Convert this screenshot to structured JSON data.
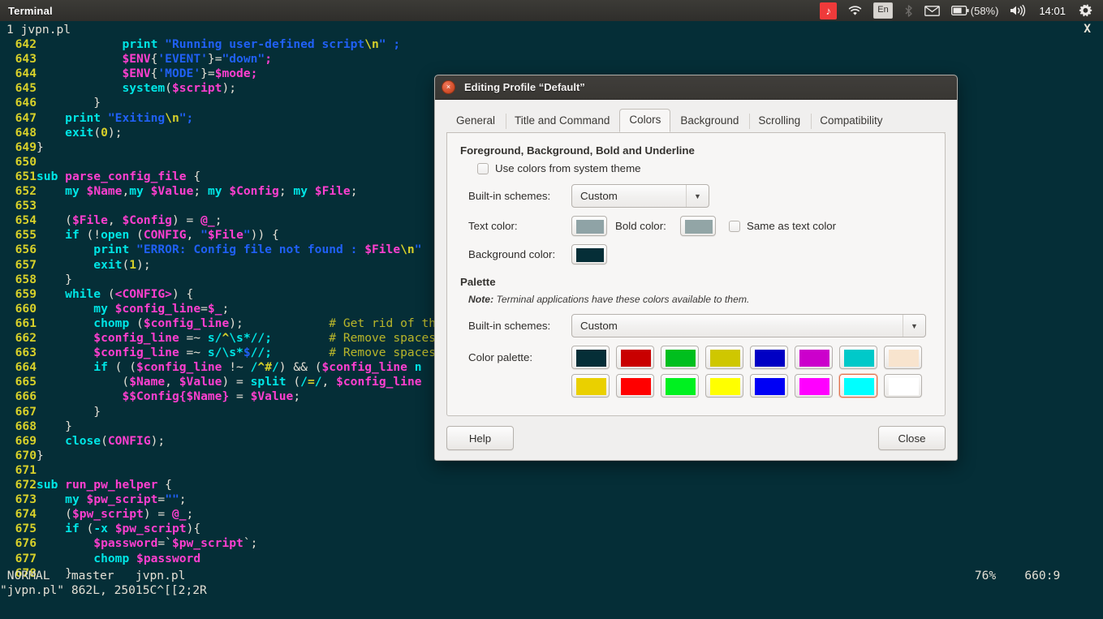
{
  "panel": {
    "title": "Terminal",
    "tray": {
      "music_icon": "music-note-icon",
      "wifi_icon": "wifi-icon",
      "language": "En",
      "bluetooth_icon": "bluetooth-icon",
      "mail_icon": "envelope-icon",
      "battery_icon": "battery-icon",
      "battery_percent": "(58%)",
      "volume_icon": "volume-icon",
      "clock": "14:01",
      "settings_icon": "gear-icon"
    }
  },
  "terminal": {
    "tab_label": "1 jvpn.pl",
    "close_glyph": "X",
    "colors": {
      "background": "#052e37",
      "foreground": "#e3dfd4",
      "linenumber": "#d7d02a",
      "keyword": "#00e5e5",
      "variable": "#ff3fd0",
      "string": "#2060f5",
      "comment": "#b9b62a"
    },
    "lines": [
      {
        "n": "642",
        "segs": [
          {
            "t": "            ",
            "c": "pln"
          },
          {
            "t": "print",
            "c": "kw"
          },
          {
            "t": " ",
            "c": "pln"
          },
          {
            "t": "\"Running user-defined script",
            "c": "str"
          },
          {
            "t": "\\n",
            "c": "esc"
          },
          {
            "t": "\" ;",
            "c": "str"
          }
        ]
      },
      {
        "n": "643",
        "segs": [
          {
            "t": "            ",
            "c": "pln"
          },
          {
            "t": "$ENV",
            "c": "var"
          },
          {
            "t": "{",
            "c": "pln"
          },
          {
            "t": "'EVENT'",
            "c": "str"
          },
          {
            "t": "}=",
            "c": "pln"
          },
          {
            "t": "\"down\"",
            "c": "str"
          },
          {
            "t": ";",
            "c": "var"
          }
        ]
      },
      {
        "n": "644",
        "segs": [
          {
            "t": "            ",
            "c": "pln"
          },
          {
            "t": "$ENV",
            "c": "var"
          },
          {
            "t": "{",
            "c": "pln"
          },
          {
            "t": "'MODE'",
            "c": "str"
          },
          {
            "t": "}=",
            "c": "pln"
          },
          {
            "t": "$mode",
            "c": "var"
          },
          {
            "t": ";",
            "c": "var"
          }
        ]
      },
      {
        "n": "645",
        "segs": [
          {
            "t": "            ",
            "c": "pln"
          },
          {
            "t": "system",
            "c": "kw"
          },
          {
            "t": "(",
            "c": "pln"
          },
          {
            "t": "$script",
            "c": "var"
          },
          {
            "t": ");",
            "c": "pln"
          }
        ]
      },
      {
        "n": "646",
        "segs": [
          {
            "t": "        }",
            "c": "pln"
          }
        ]
      },
      {
        "n": "647",
        "segs": [
          {
            "t": "    ",
            "c": "pln"
          },
          {
            "t": "print",
            "c": "kw"
          },
          {
            "t": " ",
            "c": "pln"
          },
          {
            "t": "\"Exiting",
            "c": "str"
          },
          {
            "t": "\\n",
            "c": "esc"
          },
          {
            "t": "\";",
            "c": "str"
          }
        ]
      },
      {
        "n": "648",
        "segs": [
          {
            "t": "    ",
            "c": "pln"
          },
          {
            "t": "exit",
            "c": "kw"
          },
          {
            "t": "(",
            "c": "pln"
          },
          {
            "t": "0",
            "c": "num"
          },
          {
            "t": ");",
            "c": "pln"
          }
        ]
      },
      {
        "n": "649",
        "segs": [
          {
            "t": "}",
            "c": "pln"
          }
        ]
      },
      {
        "n": "650",
        "segs": []
      },
      {
        "n": "651",
        "segs": [
          {
            "t": "sub",
            "c": "kw"
          },
          {
            "t": " ",
            "c": "pln"
          },
          {
            "t": "parse_config_file",
            "c": "var"
          },
          {
            "t": " {",
            "c": "pln"
          }
        ]
      },
      {
        "n": "652",
        "segs": [
          {
            "t": "    ",
            "c": "pln"
          },
          {
            "t": "my",
            "c": "kw"
          },
          {
            "t": " ",
            "c": "pln"
          },
          {
            "t": "$Name",
            "c": "var"
          },
          {
            "t": ",",
            "c": "pln"
          },
          {
            "t": "my",
            "c": "kw"
          },
          {
            "t": " ",
            "c": "pln"
          },
          {
            "t": "$Value",
            "c": "var"
          },
          {
            "t": "; ",
            "c": "pln"
          },
          {
            "t": "my",
            "c": "kw"
          },
          {
            "t": " ",
            "c": "pln"
          },
          {
            "t": "$Config",
            "c": "var"
          },
          {
            "t": "; ",
            "c": "pln"
          },
          {
            "t": "my",
            "c": "kw"
          },
          {
            "t": " ",
            "c": "pln"
          },
          {
            "t": "$File",
            "c": "var"
          },
          {
            "t": ";",
            "c": "pln"
          }
        ]
      },
      {
        "n": "653",
        "segs": []
      },
      {
        "n": "654",
        "segs": [
          {
            "t": "    (",
            "c": "pln"
          },
          {
            "t": "$File",
            "c": "var"
          },
          {
            "t": ", ",
            "c": "pln"
          },
          {
            "t": "$Config",
            "c": "var"
          },
          {
            "t": ") = ",
            "c": "pln"
          },
          {
            "t": "@_",
            "c": "var"
          },
          {
            "t": ";",
            "c": "pln"
          }
        ]
      },
      {
        "n": "655",
        "segs": [
          {
            "t": "    ",
            "c": "pln"
          },
          {
            "t": "if",
            "c": "kw"
          },
          {
            "t": " (!",
            "c": "pln"
          },
          {
            "t": "open",
            "c": "kw"
          },
          {
            "t": " (",
            "c": "pln"
          },
          {
            "t": "CONFIG",
            "c": "var"
          },
          {
            "t": ", ",
            "c": "pln"
          },
          {
            "t": "\"",
            "c": "str"
          },
          {
            "t": "$File",
            "c": "var"
          },
          {
            "t": "\"",
            "c": "str"
          },
          {
            "t": ")) {",
            "c": "pln"
          }
        ]
      },
      {
        "n": "656",
        "segs": [
          {
            "t": "        ",
            "c": "pln"
          },
          {
            "t": "print",
            "c": "kw"
          },
          {
            "t": " ",
            "c": "pln"
          },
          {
            "t": "\"ERROR: Config file not found : ",
            "c": "str"
          },
          {
            "t": "$File",
            "c": "var"
          },
          {
            "t": "\\n",
            "c": "esc"
          },
          {
            "t": "\"",
            "c": "str"
          }
        ]
      },
      {
        "n": "657",
        "segs": [
          {
            "t": "        ",
            "c": "pln"
          },
          {
            "t": "exit",
            "c": "kw"
          },
          {
            "t": "(",
            "c": "pln"
          },
          {
            "t": "1",
            "c": "num"
          },
          {
            "t": ");",
            "c": "pln"
          }
        ]
      },
      {
        "n": "658",
        "segs": [
          {
            "t": "    }",
            "c": "pln"
          }
        ]
      },
      {
        "n": "659",
        "segs": [
          {
            "t": "    ",
            "c": "pln"
          },
          {
            "t": "while",
            "c": "kw"
          },
          {
            "t": " (",
            "c": "pln"
          },
          {
            "t": "<CONFIG>",
            "c": "var"
          },
          {
            "t": ") {",
            "c": "pln"
          }
        ]
      },
      {
        "n": "660",
        "segs": [
          {
            "t": "        ",
            "c": "pln"
          },
          {
            "t": "my",
            "c": "kw"
          },
          {
            "t": " ",
            "c": "pln"
          },
          {
            "t": "$config_line",
            "c": "var"
          },
          {
            "t": "=",
            "c": "pln"
          },
          {
            "t": "$_",
            "c": "var"
          },
          {
            "t": ";",
            "c": "pln"
          }
        ]
      },
      {
        "n": "661",
        "segs": [
          {
            "t": "        ",
            "c": "pln"
          },
          {
            "t": "chomp",
            "c": "kw"
          },
          {
            "t": " (",
            "c": "pln"
          },
          {
            "t": "$config_line",
            "c": "var"
          },
          {
            "t": ");            ",
            "c": "pln"
          },
          {
            "t": "# Get rid of the",
            "c": "cmt"
          }
        ]
      },
      {
        "n": "662",
        "segs": [
          {
            "t": "        ",
            "c": "pln"
          },
          {
            "t": "$config_line",
            "c": "var"
          },
          {
            "t": " =~ ",
            "c": "pln"
          },
          {
            "t": "s/",
            "c": "kw"
          },
          {
            "t": "^",
            "c": "esc"
          },
          {
            "t": "\\s*",
            "c": "kw"
          },
          {
            "t": "//;",
            "c": "kw"
          },
          {
            "t": "        ",
            "c": "pln"
          },
          {
            "t": "# Remove spaces a",
            "c": "cmt"
          }
        ]
      },
      {
        "n": "663",
        "segs": [
          {
            "t": "        ",
            "c": "pln"
          },
          {
            "t": "$config_line",
            "c": "var"
          },
          {
            "t": " =~ ",
            "c": "pln"
          },
          {
            "t": "s/",
            "c": "kw"
          },
          {
            "t": "\\s*",
            "c": "kw"
          },
          {
            "t": "$",
            "c": "str"
          },
          {
            "t": "//;",
            "c": "kw"
          },
          {
            "t": "        ",
            "c": "pln"
          },
          {
            "t": "# Remove spaces a",
            "c": "cmt"
          }
        ]
      },
      {
        "n": "664",
        "segs": [
          {
            "t": "        ",
            "c": "pln"
          },
          {
            "t": "if",
            "c": "kw"
          },
          {
            "t": " ( (",
            "c": "pln"
          },
          {
            "t": "$config_line",
            "c": "var"
          },
          {
            "t": " !~ ",
            "c": "pln"
          },
          {
            "t": "/",
            "c": "kw"
          },
          {
            "t": "^#",
            "c": "esc"
          },
          {
            "t": "/",
            "c": "kw"
          },
          {
            "t": ") && (",
            "c": "pln"
          },
          {
            "t": "$config_line",
            "c": "var"
          },
          {
            "t": " n",
            "c": "kw"
          }
        ]
      },
      {
        "n": "665",
        "segs": [
          {
            "t": "            (",
            "c": "pln"
          },
          {
            "t": "$Name",
            "c": "var"
          },
          {
            "t": ", ",
            "c": "pln"
          },
          {
            "t": "$Value",
            "c": "var"
          },
          {
            "t": ") = ",
            "c": "pln"
          },
          {
            "t": "split",
            "c": "kw"
          },
          {
            "t": " (",
            "c": "pln"
          },
          {
            "t": "/",
            "c": "kw"
          },
          {
            "t": "=",
            "c": "esc"
          },
          {
            "t": "/",
            "c": "kw"
          },
          {
            "t": ", ",
            "c": "pln"
          },
          {
            "t": "$config_line",
            "c": "var"
          }
        ]
      },
      {
        "n": "666",
        "segs": [
          {
            "t": "            ",
            "c": "pln"
          },
          {
            "t": "$$Config{$Name}",
            "c": "var"
          },
          {
            "t": " = ",
            "c": "pln"
          },
          {
            "t": "$Value",
            "c": "var"
          },
          {
            "t": ";",
            "c": "pln"
          }
        ]
      },
      {
        "n": "667",
        "segs": [
          {
            "t": "        }",
            "c": "pln"
          }
        ]
      },
      {
        "n": "668",
        "segs": [
          {
            "t": "    }",
            "c": "pln"
          }
        ]
      },
      {
        "n": "669",
        "segs": [
          {
            "t": "    ",
            "c": "pln"
          },
          {
            "t": "close",
            "c": "kw"
          },
          {
            "t": "(",
            "c": "pln"
          },
          {
            "t": "CONFIG",
            "c": "var"
          },
          {
            "t": ");",
            "c": "pln"
          }
        ]
      },
      {
        "n": "670",
        "segs": [
          {
            "t": "}",
            "c": "pln"
          }
        ]
      },
      {
        "n": "671",
        "segs": []
      },
      {
        "n": "672",
        "segs": [
          {
            "t": "sub",
            "c": "kw"
          },
          {
            "t": " ",
            "c": "pln"
          },
          {
            "t": "run_pw_helper",
            "c": "var"
          },
          {
            "t": " {",
            "c": "pln"
          }
        ]
      },
      {
        "n": "673",
        "segs": [
          {
            "t": "    ",
            "c": "pln"
          },
          {
            "t": "my",
            "c": "kw"
          },
          {
            "t": " ",
            "c": "pln"
          },
          {
            "t": "$pw_script",
            "c": "var"
          },
          {
            "t": "=",
            "c": "pln"
          },
          {
            "t": "\"\"",
            "c": "str"
          },
          {
            "t": ";",
            "c": "pln"
          }
        ]
      },
      {
        "n": "674",
        "segs": [
          {
            "t": "    (",
            "c": "pln"
          },
          {
            "t": "$pw_script",
            "c": "var"
          },
          {
            "t": ") = ",
            "c": "pln"
          },
          {
            "t": "@_",
            "c": "var"
          },
          {
            "t": ";",
            "c": "pln"
          }
        ]
      },
      {
        "n": "675",
        "segs": [
          {
            "t": "    ",
            "c": "pln"
          },
          {
            "t": "if",
            "c": "kw"
          },
          {
            "t": " (",
            "c": "pln"
          },
          {
            "t": "-x",
            "c": "kw"
          },
          {
            "t": " ",
            "c": "pln"
          },
          {
            "t": "$pw_script",
            "c": "var"
          },
          {
            "t": "){",
            "c": "pln"
          }
        ]
      },
      {
        "n": "676",
        "segs": [
          {
            "t": "        ",
            "c": "pln"
          },
          {
            "t": "$password",
            "c": "var"
          },
          {
            "t": "=`",
            "c": "pln"
          },
          {
            "t": "$pw_script",
            "c": "var"
          },
          {
            "t": "`;",
            "c": "pln"
          }
        ]
      },
      {
        "n": "677",
        "segs": [
          {
            "t": "        ",
            "c": "pln"
          },
          {
            "t": "chomp",
            "c": "kw"
          },
          {
            "t": " ",
            "c": "pln"
          },
          {
            "t": "$password",
            "c": "var"
          }
        ]
      },
      {
        "n": "678",
        "segs": [
          {
            "t": "    }",
            "c": "pln"
          }
        ]
      }
    ],
    "status": {
      "mode": "NORMAL",
      "branch": "master",
      "file": "jvpn.pl",
      "percent": "76%",
      "position": "660:9"
    },
    "command_line": "\"jvpn.pl\" 862L, 25015C^[[2;2R"
  },
  "dialog": {
    "title": "Editing Profile “Default”",
    "close_glyph": "×",
    "tabs": [
      {
        "label": "General",
        "active": false
      },
      {
        "label": "Title and Command",
        "active": false
      },
      {
        "label": "Colors",
        "active": true
      },
      {
        "label": "Background",
        "active": false
      },
      {
        "label": "Scrolling",
        "active": false
      },
      {
        "label": "Compatibility",
        "active": false
      }
    ],
    "colors_tab": {
      "section1_title": "Foreground, Background, Bold and Underline",
      "use_system_theme_label": "Use colors from system theme",
      "use_system_theme_checked": false,
      "builtin_schemes_label": "Built-in schemes:",
      "builtin_schemes_value": "Custom",
      "text_color_label": "Text color:",
      "text_color_value": "#8fa3a6",
      "bold_color_label": "Bold color:",
      "bold_color_value": "#92a5a6",
      "same_as_text_label": "Same as text color",
      "same_as_text_checked": false,
      "background_color_label": "Background color:",
      "background_color_value": "#052e37",
      "palette_title": "Palette",
      "palette_note_prefix": "Note:",
      "palette_note": " Terminal applications have these colors available to them.",
      "palette_schemes_label": "Built-in schemes:",
      "palette_schemes_value": "Custom",
      "color_palette_label": "Color palette:",
      "palette_row1": [
        "#052e37",
        "#c90000",
        "#00bf1e",
        "#cfc700",
        "#0000c4",
        "#cc00cc",
        "#00c9c9",
        "#f8e4ce"
      ],
      "palette_row2": [
        "#ead000",
        "#ff0000",
        "#00f120",
        "#ffff00",
        "#0000f5",
        "#ff00ff",
        "#00ffff",
        "#ffffff"
      ],
      "selected_swatch_row": 2,
      "selected_swatch_index": 6
    },
    "footer": {
      "help_label": "Help",
      "close_label": "Close"
    }
  }
}
